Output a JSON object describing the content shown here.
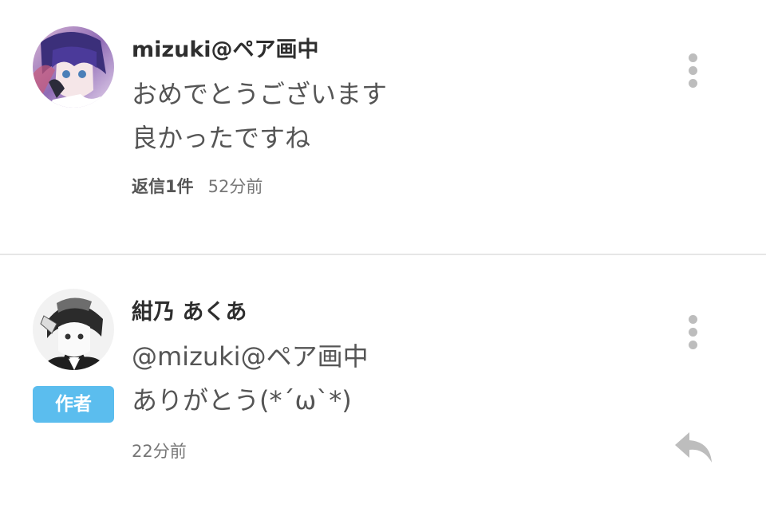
{
  "comments": [
    {
      "username": "mizuki@ペア画中",
      "body_lines": [
        "おめでとうございます",
        "良かったですね"
      ],
      "replies_label": "返信1件",
      "time": "52分前",
      "avatar": "avatar-illustration-purple-hair",
      "menu_icon": "kebab-menu-icon"
    },
    {
      "username": "紺乃 あくあ",
      "body_lines": [
        "@mizuki@ペア画中",
        "ありがとう(*´ω`*)"
      ],
      "badge": "作者",
      "time": "22分前",
      "avatar": "avatar-illustration-monochrome",
      "menu_icon": "kebab-menu-icon",
      "reply_icon": "reply-arrow-icon"
    }
  ],
  "colors": {
    "badge_bg": "#5bbdee",
    "divider": "#e6e6e6",
    "icon_gray": "#bdbdbd"
  }
}
